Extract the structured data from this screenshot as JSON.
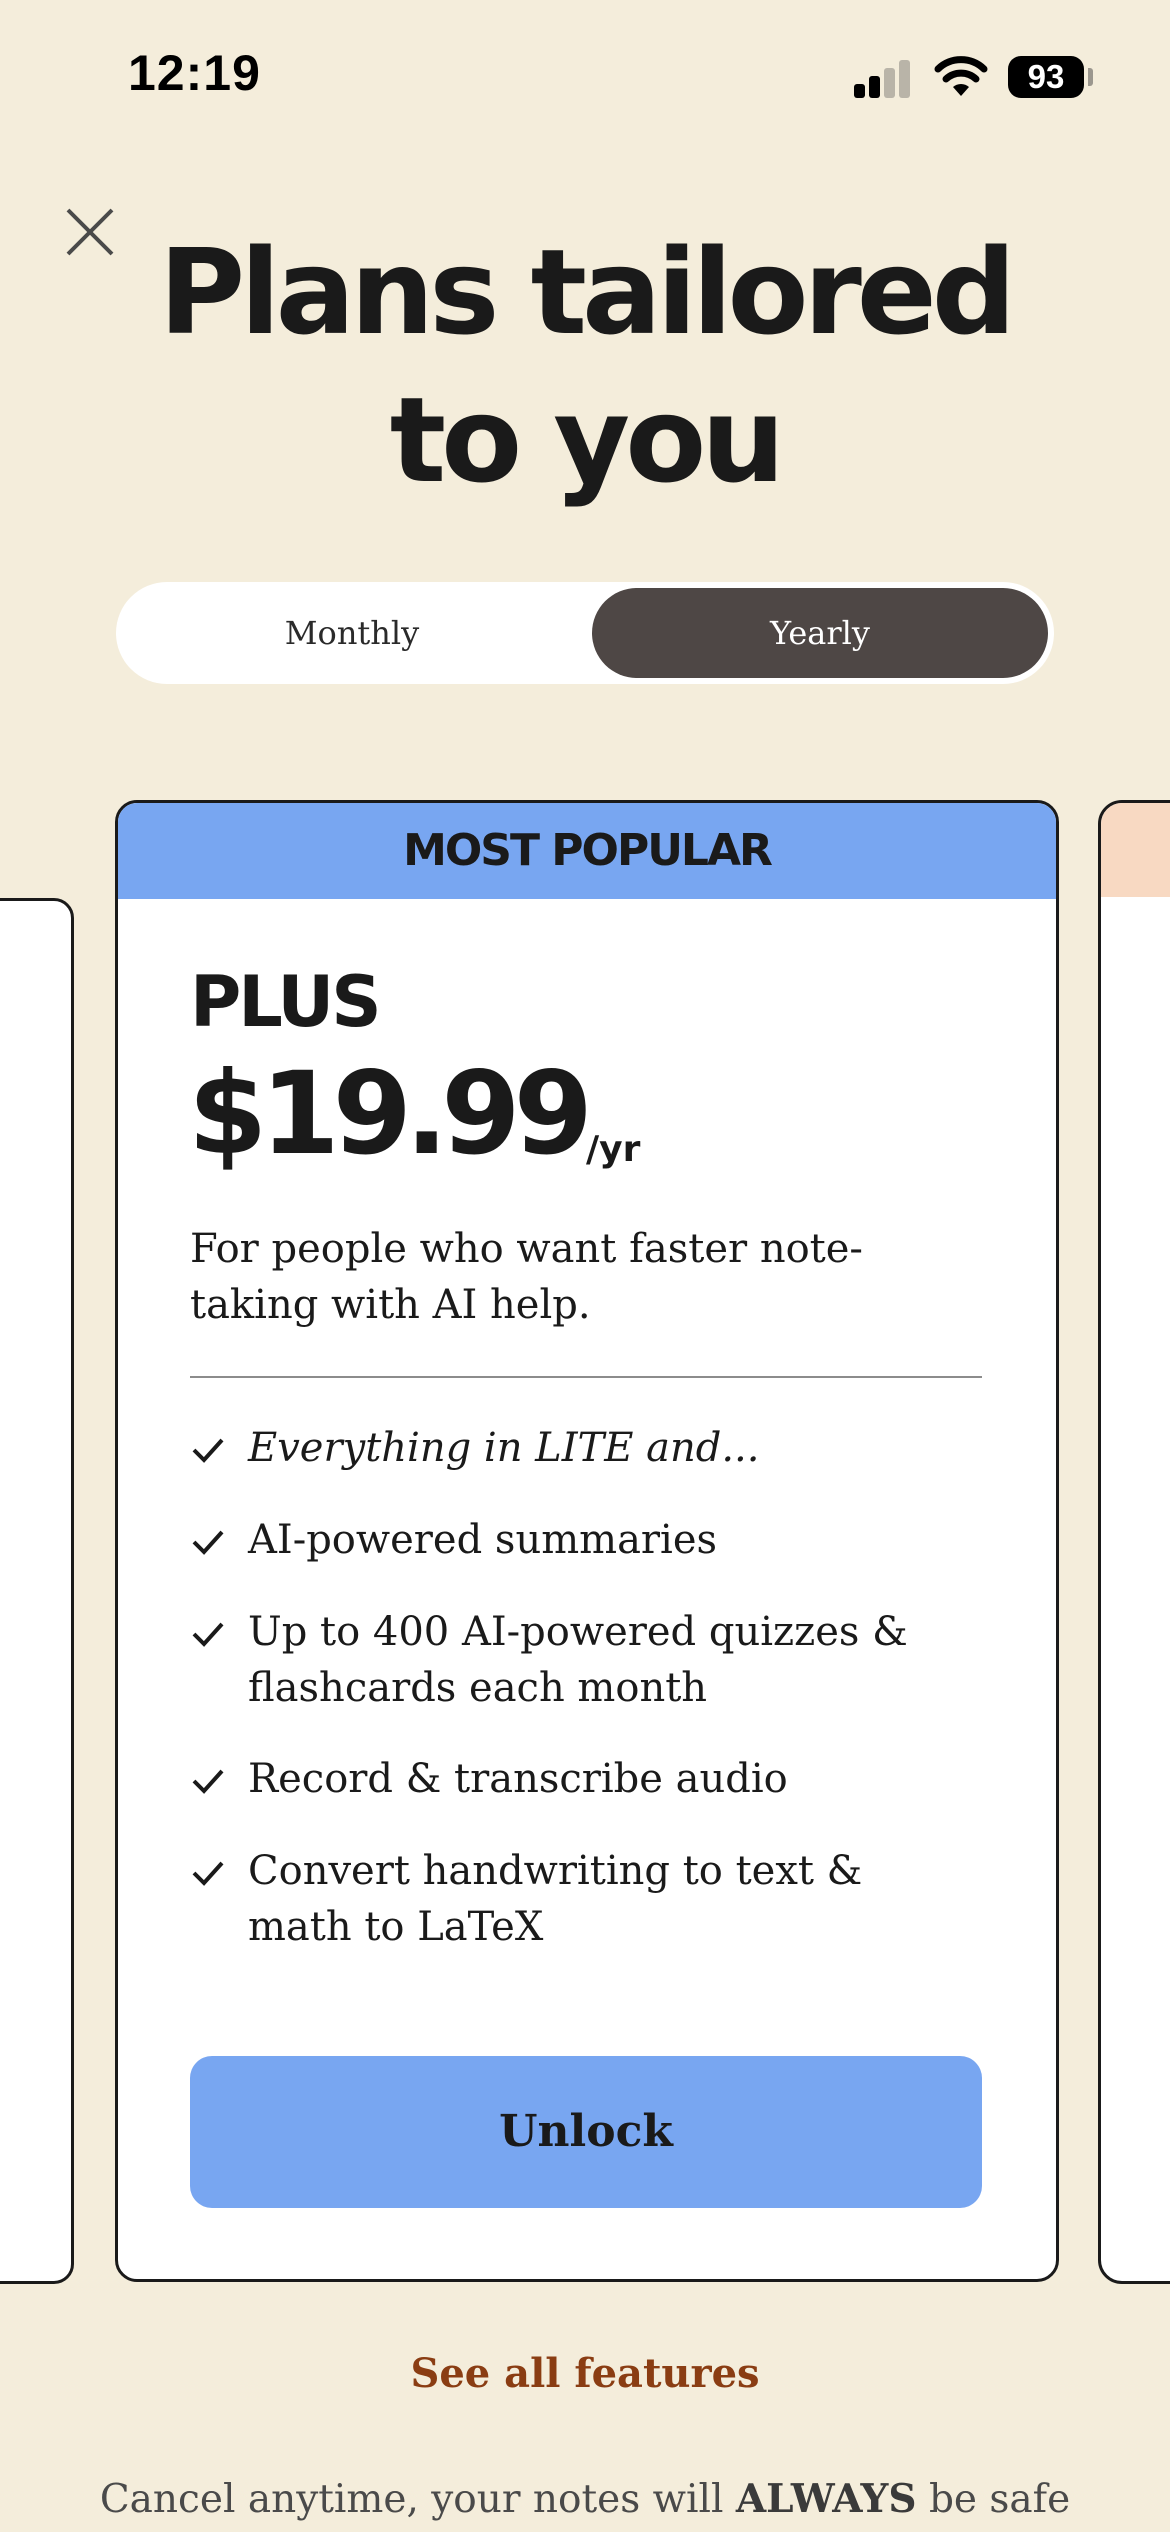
{
  "status_bar": {
    "time": "12:19",
    "battery": "93"
  },
  "header": {
    "close_icon": "close-icon",
    "title_line1": "Plans tailored",
    "title_line2": "to you"
  },
  "billing_toggle": {
    "options": [
      "Monthly",
      "Yearly"
    ],
    "selected": "Yearly"
  },
  "plan": {
    "banner": "MOST POPULAR",
    "name": "PLUS",
    "price": "$19.99",
    "period": "/yr",
    "description": "For people who want faster note-taking with AI help.",
    "features": [
      "Everything in LITE and...",
      "AI-powered summaries",
      "Up to 400 AI-powered quizzes & flashcards each month",
      "Record & transcribe audio",
      "Convert handwriting to text & math to LaTeX"
    ],
    "button": "Unlock"
  },
  "colors": {
    "background": "#f4eddb",
    "accent_blue": "#78a6f1",
    "toggle_selected": "#4e4745",
    "link": "#8a3d13",
    "side_card_band": "#f8d9c2"
  },
  "links": {
    "see_all": "See all features"
  },
  "footer": {
    "prefix": "Cancel anytime, your notes will ",
    "emphasis": "ALWAYS",
    "suffix": " be safe"
  }
}
